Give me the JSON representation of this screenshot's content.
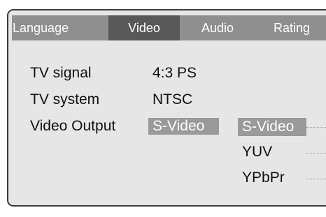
{
  "tabs": [
    {
      "label": "Language",
      "active": false
    },
    {
      "label": "Video",
      "active": true
    },
    {
      "label": "Audio",
      "active": false
    },
    {
      "label": "Rating",
      "active": false
    }
  ],
  "settings": [
    {
      "label": "TV signal",
      "value": "4:3 PS"
    },
    {
      "label": "TV system",
      "value": "NTSC"
    },
    {
      "label": "Video Output",
      "value": "S-Video",
      "selected": true
    }
  ],
  "video_output_options": [
    {
      "label": "S-Video",
      "selected": true
    },
    {
      "label": "YUV",
      "selected": false
    },
    {
      "label": "YPbPr",
      "selected": false
    }
  ],
  "colors": {
    "panel_background": "#e6e6e6",
    "tab_bar": "#8f8f8f",
    "active_tab": "#585858",
    "selection": "#9a9a9a",
    "text": "#111111"
  }
}
